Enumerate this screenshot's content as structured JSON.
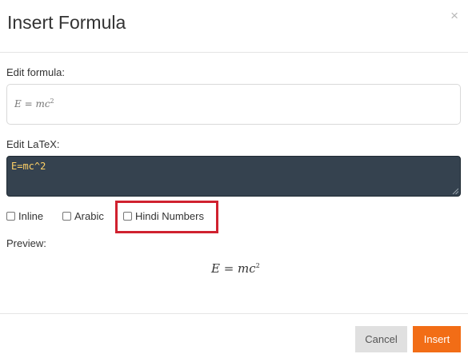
{
  "dialog": {
    "title": "Insert Formula",
    "close_glyph": "×"
  },
  "edit_formula": {
    "label": "Edit formula:",
    "value_lhs": "E = mc",
    "value_exp": "2"
  },
  "edit_latex": {
    "label": "Edit LaTeX:",
    "value": "E=mc^2"
  },
  "options": [
    {
      "label": "Inline",
      "checked": false
    },
    {
      "label": "Arabic",
      "checked": false
    },
    {
      "label": "Hindi Numbers",
      "checked": false
    }
  ],
  "preview": {
    "label": "Preview:",
    "formula_lhs": "E = mc",
    "formula_exp": "2"
  },
  "buttons": {
    "cancel": "Cancel",
    "insert": "Insert"
  },
  "colors": {
    "insert_button": "#f26d16",
    "latex_bg": "#35424f",
    "latex_text": "#ffd166",
    "highlight": "#d0212f"
  },
  "icons": {
    "close": "close-icon",
    "resize": "resize-handle-icon"
  }
}
